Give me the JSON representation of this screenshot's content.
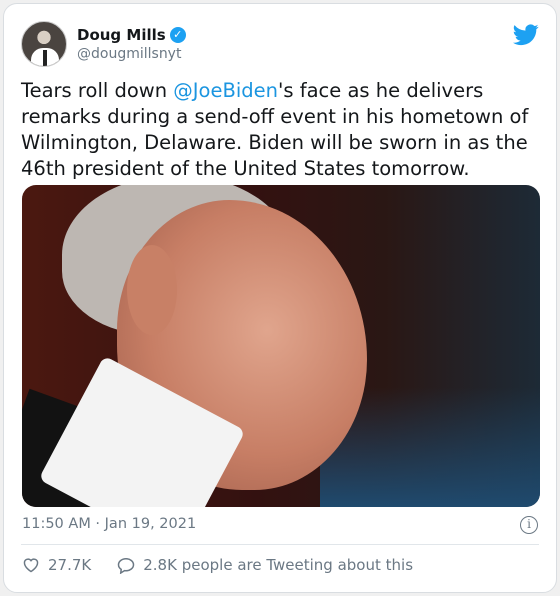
{
  "author": {
    "display_name": "Doug Mills",
    "handle": "@dougmillsnyt",
    "verified": true
  },
  "tweet": {
    "text_before_mention": "Tears roll down ",
    "mention": "@JoeBiden",
    "text_after_mention": "'s face  as he delivers remarks during a send-off event in his hometown of Wilmington, Delaware. Biden will be sworn in as the 46th president of the United States tomorrow.",
    "timestamp": "11:50 AM · Jan 19, 2021"
  },
  "stats": {
    "likes": "27.7K",
    "tweeting_about": "2.8K people are Tweeting about this"
  },
  "icons": {
    "brand": "twitter-bird-icon",
    "verified": "verified-badge-icon",
    "info": "info-icon",
    "like": "heart-icon",
    "reply": "speech-bubble-icon"
  },
  "colors": {
    "accent": "#1da1f2",
    "mention": "#1b95e0",
    "muted": "#6b7884"
  }
}
